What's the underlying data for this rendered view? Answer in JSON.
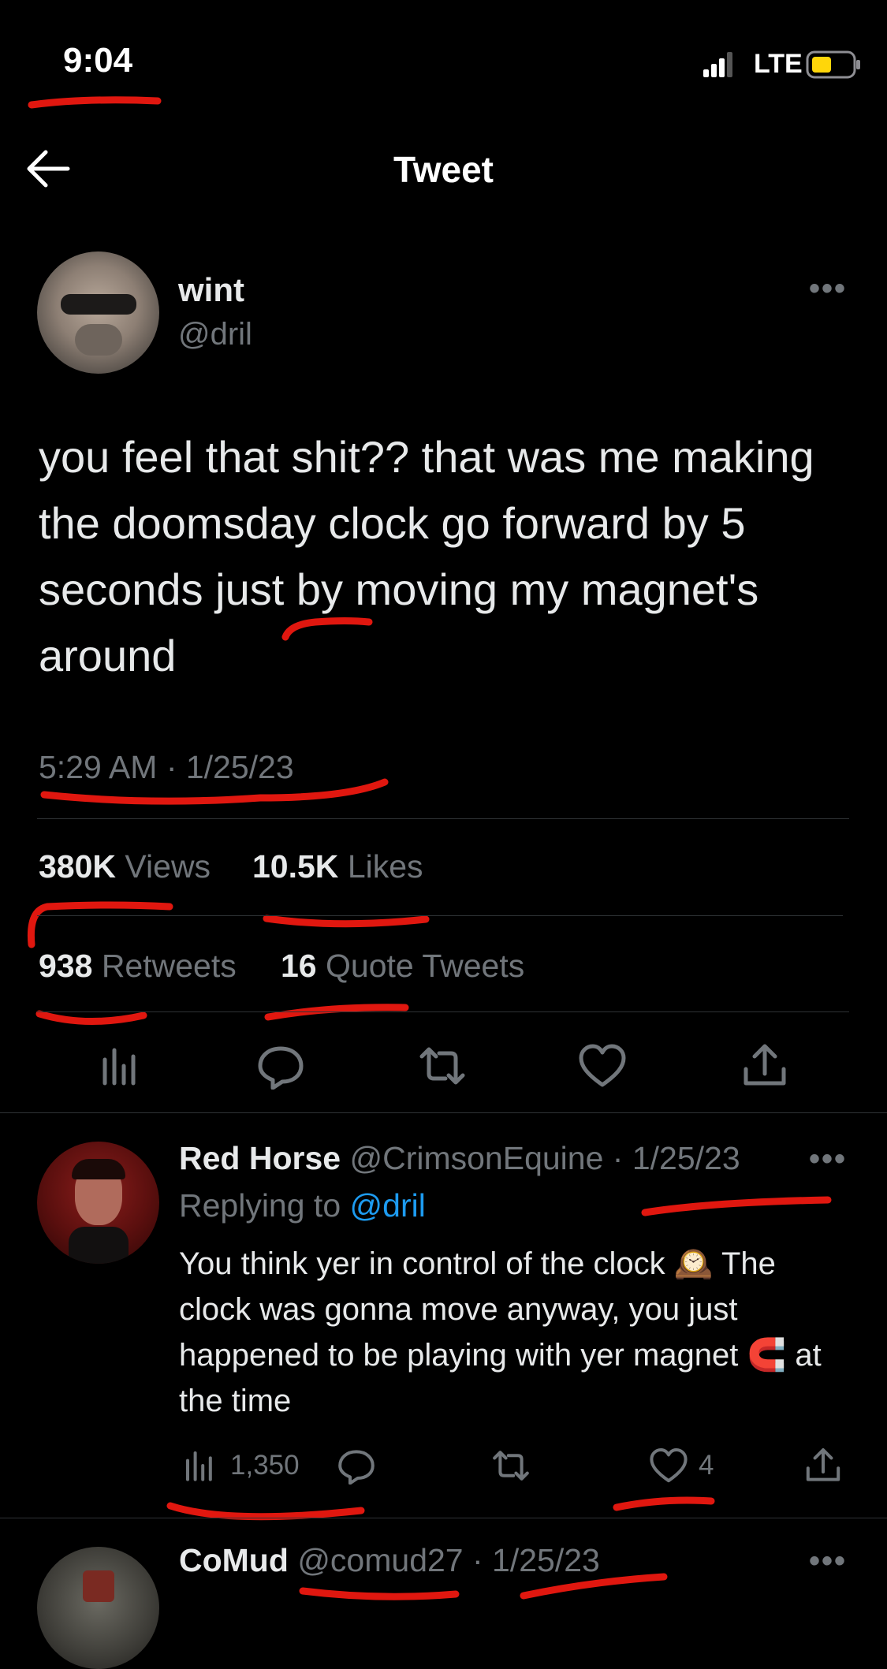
{
  "status_bar": {
    "time": "9:04",
    "network": "LTE",
    "battery_color": "#ffd60a"
  },
  "header": {
    "back_icon": "arrow-left-icon",
    "title": "Tweet"
  },
  "tweet": {
    "author_name": "wint",
    "author_handle": "@dril",
    "text": "you feel that shit?? that was me making the doomsday clock go forward by 5 seconds just by moving my magnet's around",
    "timestamp": "5:29 AM · 1/25/23",
    "stats": {
      "views_count": "380K",
      "views_label": "Views",
      "likes_count": "10.5K",
      "likes_label": "Likes",
      "retweets_count": "938",
      "retweets_label": "Retweets",
      "quotes_count": "16",
      "quotes_label": "Quote Tweets"
    },
    "actions": [
      "analytics-icon",
      "reply-icon",
      "retweet-icon",
      "like-icon",
      "share-icon"
    ]
  },
  "replies": [
    {
      "name": "Red Horse",
      "handle": "@CrimsonEquine",
      "date": "· 1/25/23",
      "replying_prefix": "Replying to ",
      "replying_to": "@dril",
      "text_part1": "You think yer in control of the clock ",
      "emoji1": "🕰️",
      "text_part2": " The clock was gonna move anyway, you just happened to be playing with yer magnet ",
      "emoji2": "🧲",
      "text_part3": " at the time",
      "views": "1,350",
      "likes": "4"
    },
    {
      "name": "CoMud",
      "handle": "@comud27",
      "date": "· 1/25/23"
    }
  ],
  "colors": {
    "background": "#000000",
    "text": "#e7e9ea",
    "muted": "#71767b",
    "link": "#1d9bf0",
    "annotation": "#e0170f"
  }
}
